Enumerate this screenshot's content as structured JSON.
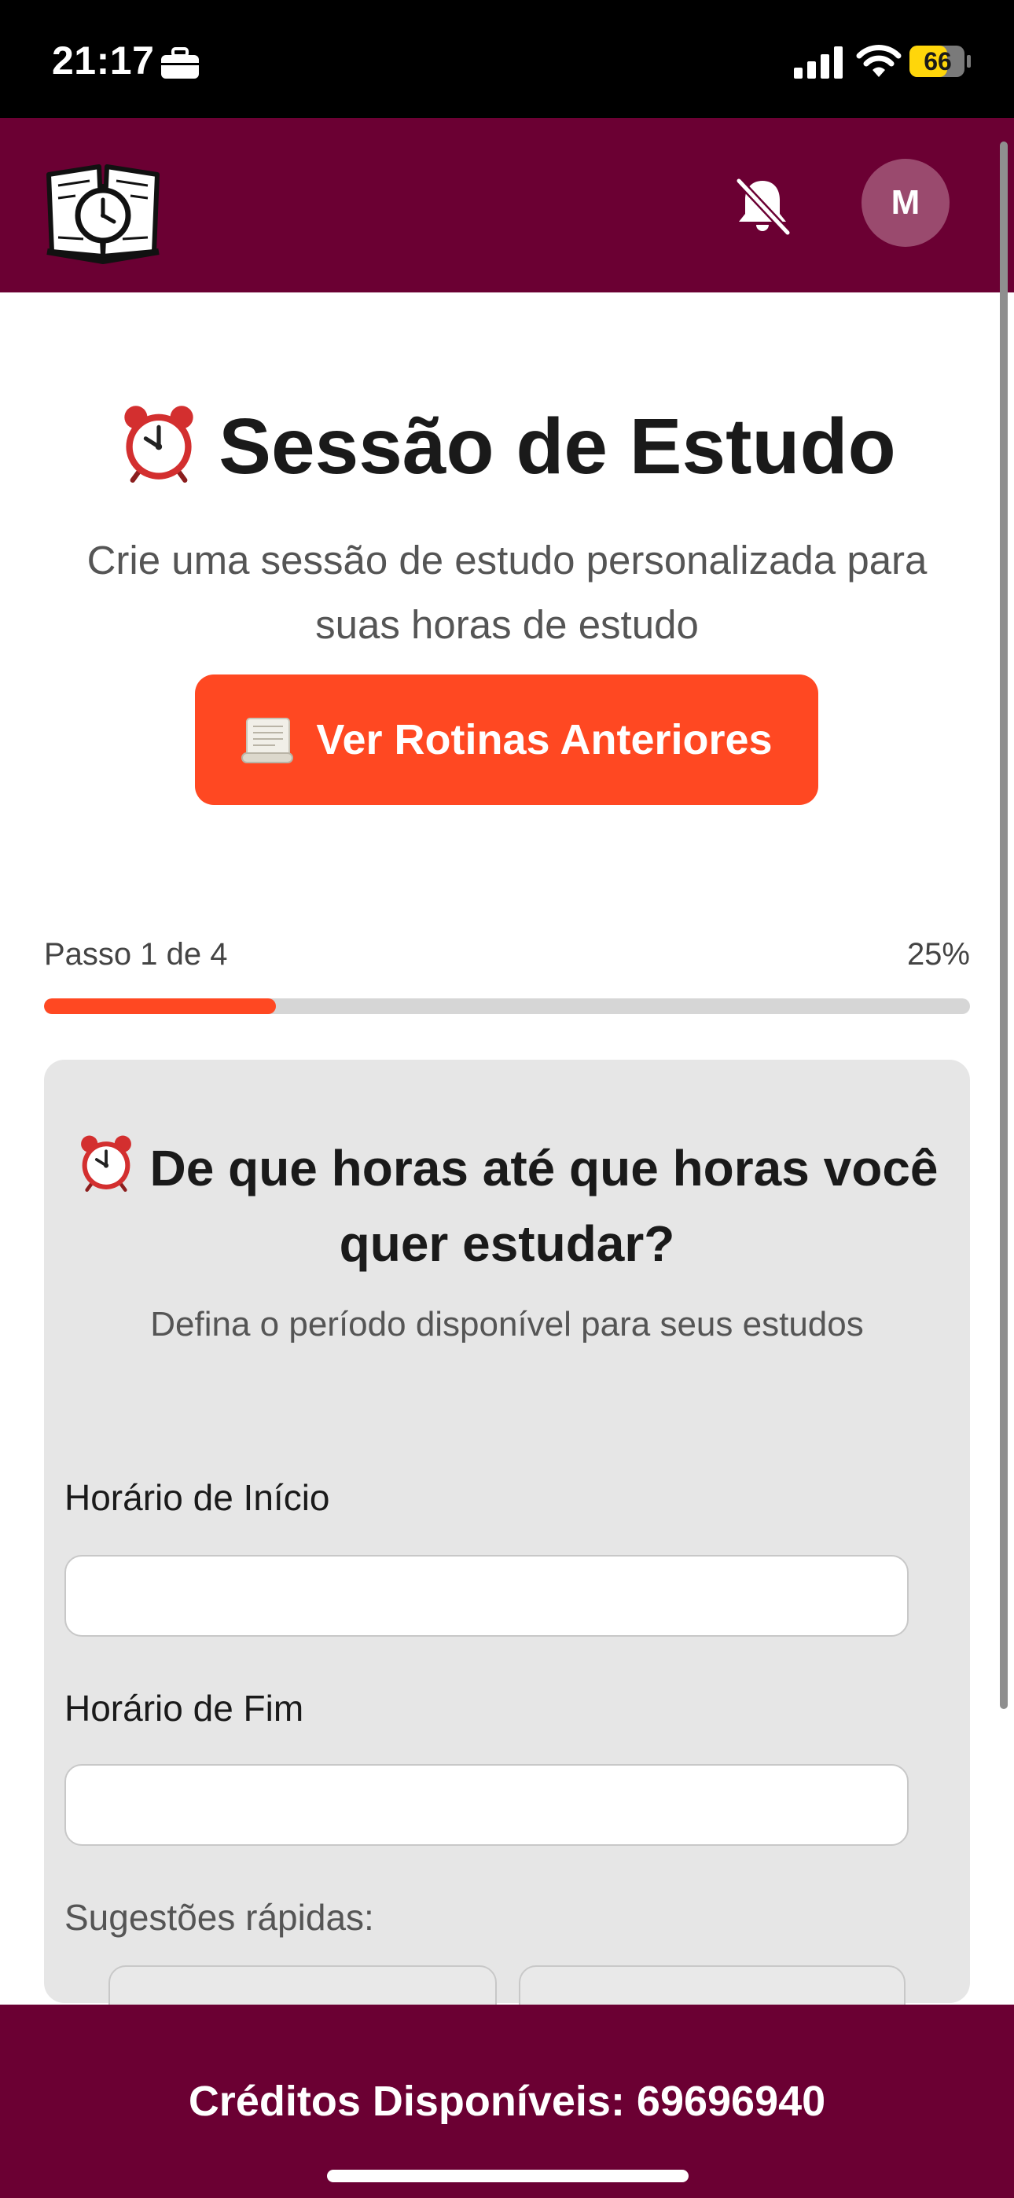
{
  "status_bar": {
    "time": "21:17",
    "battery": "66",
    "icons": [
      "briefcase-icon",
      "signal-icon",
      "wifi-icon",
      "battery-icon"
    ]
  },
  "header": {
    "logo_icon": "book-clock-logo-icon",
    "notification_icon": "bell-off-icon",
    "avatar_initial": "M",
    "colors": {
      "background": "#6b0033",
      "avatar": "#9a4a6e"
    }
  },
  "hero": {
    "title": "Sessão de Estudo",
    "subtitle": "Crie uma sessão de estudo personalizada para suas horas de estudo",
    "routines_button": "Ver Rotinas Anteriores",
    "colors": {
      "accent": "#ff4822"
    }
  },
  "progress": {
    "step_label": "Passo 1 de 4",
    "percent_label": "25%",
    "value": 0.25
  },
  "card": {
    "title": "De que horas até que horas você quer estudar?",
    "subtitle": "Defina o período disponível para seus estudos",
    "start_label": "Horário de Início",
    "start_value": "",
    "end_label": "Horário de Fim",
    "end_value": "",
    "suggestions_label": "Sugestões rápidas:"
  },
  "footer": {
    "credits": "Créditos Disponíveis: 69696940"
  }
}
